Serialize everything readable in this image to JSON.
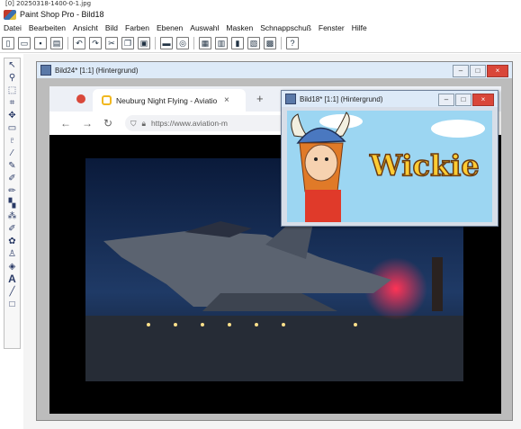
{
  "file_label": "[0] 20250318-1400-0-1.jpg",
  "app": {
    "title": "Paint Shop Pro - Bild18"
  },
  "menu": [
    "Datei",
    "Bearbeiten",
    "Ansicht",
    "Bild",
    "Farben",
    "Ebenen",
    "Auswahl",
    "Masken",
    "Schnappschuß",
    "Fenster",
    "Hilfe"
  ],
  "main_doc": {
    "title": "Bild24* [1:1] (Hintergrund)"
  },
  "overlay_doc": {
    "title": "Bild18* [1:1] (Hintergrund)",
    "logo_text": "Wickie"
  },
  "browser": {
    "tab_title": "Neuburg Night Flying - Aviatio",
    "tab_close": "×",
    "new_tab": "+",
    "url": "https://www.aviation-m"
  },
  "window_buttons": {
    "minimize": "–",
    "maximize": "□",
    "close": "×"
  },
  "icons": {
    "toolbar": [
      "new-icon",
      "open-icon",
      "save-icon",
      "print-icon",
      "undo-icon",
      "redo-icon",
      "cut-icon",
      "copy-icon",
      "paste-icon",
      "screen-icon",
      "web-icon",
      "browse-icon",
      "histogram-icon",
      "color-icon",
      "layers-icon",
      "image-icon",
      "help-icon"
    ],
    "tools": [
      "arrow-icon",
      "zoom-icon",
      "deform-icon",
      "crop-icon",
      "mover-icon",
      "selection-icon",
      "lasso-icon",
      "dropper-icon",
      "paint-brush-icon",
      "clone-icon",
      "retouch-icon",
      "color-replacer-icon",
      "scratch-remover-icon",
      "eraser-icon",
      "picture-tube-icon",
      "airbrush-icon",
      "fill-icon",
      "text-icon",
      "line-icon",
      "rectangle-icon"
    ]
  },
  "colors": {
    "close_red": "#d9473a",
    "title_blue": "#ddeaf8",
    "sky_blue": "#8fd0f0"
  }
}
